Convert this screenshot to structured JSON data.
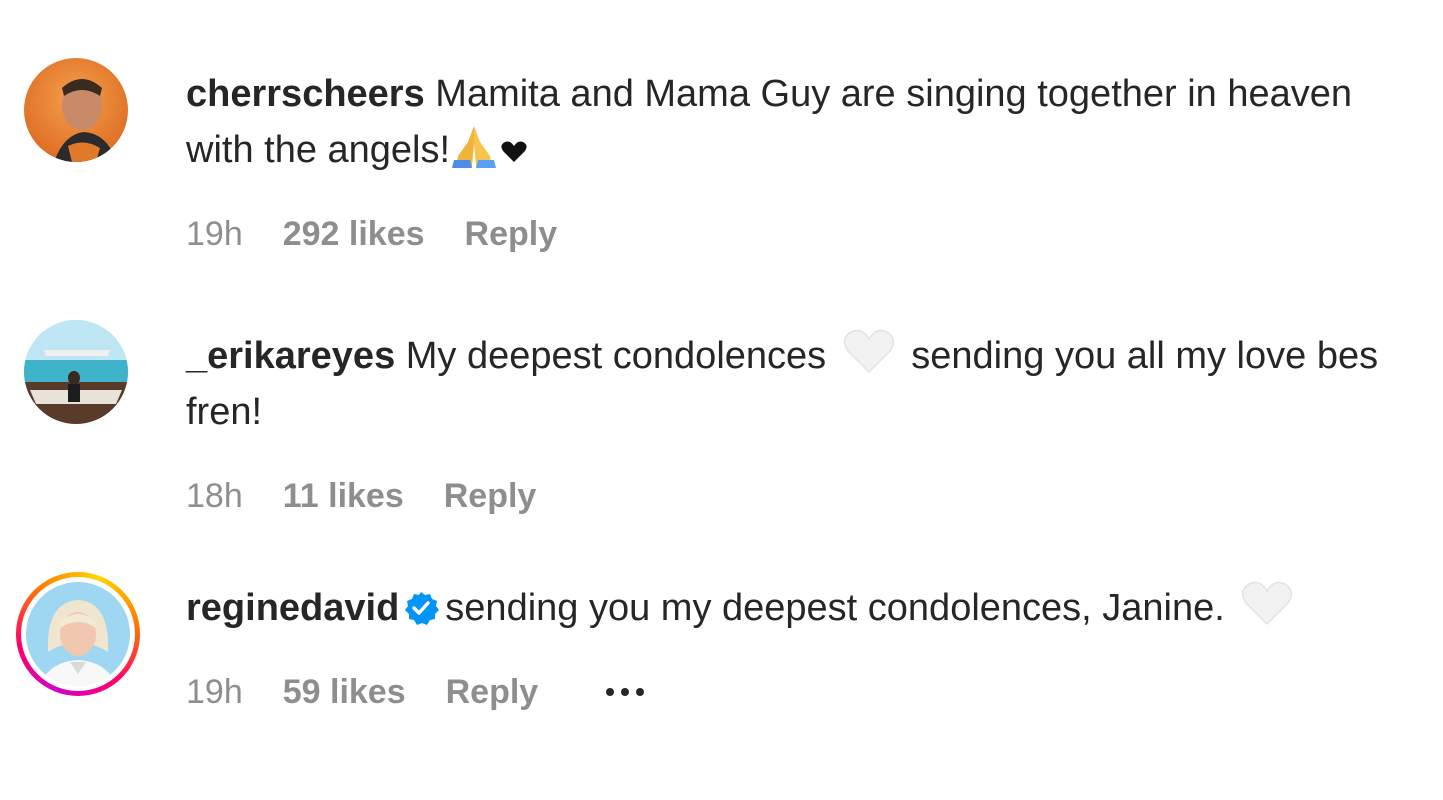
{
  "comments": [
    {
      "username": "cherrscheers",
      "text": "Mamita and Mama Guy are singing together in heaven with the angels!",
      "emojis": [
        "folded-hands-icon",
        "black-heart-icon"
      ],
      "time": "19h",
      "likes": "292 likes",
      "reply": "Reply",
      "verified": false
    },
    {
      "username": "_erikareyes",
      "text_before": "My deepest condolences",
      "text_after": " sending you all my love bes fren!",
      "emojis": [
        "white-heart-icon"
      ],
      "time": "18h",
      "likes": "11 likes",
      "reply": "Reply",
      "verified": false
    },
    {
      "username": "reginedavid",
      "text": "sending you my deepest condolences, Janine.",
      "emojis": [
        "white-heart-icon"
      ],
      "time": "19h",
      "likes": "59 likes",
      "reply": "Reply",
      "verified": true,
      "has_story_ring": true,
      "more_options": "more-options-icon"
    }
  ],
  "colors": {
    "text": "#262626",
    "meta": "#8e8e8e",
    "verified": "#0095f6"
  }
}
